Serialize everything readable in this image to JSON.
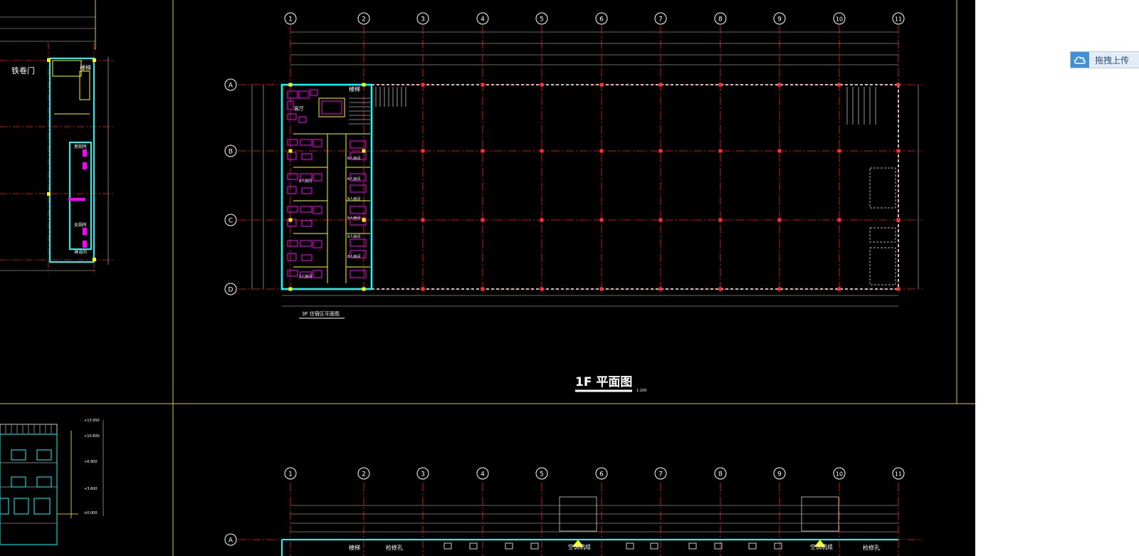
{
  "drawing": {
    "top_plan": {
      "title": "1F 平面图",
      "scale": "1:100",
      "sub_title": "3F 住宿区平面图",
      "grid_cols": [
        "1",
        "2",
        "3",
        "4",
        "5",
        "6",
        "7",
        "8",
        "9",
        "10",
        "11"
      ],
      "grid_rows": [
        "A",
        "B",
        "C",
        "D"
      ],
      "room_labels": [
        "楼梯",
        "客厅",
        "8人房间",
        "8人房间",
        "8人房间",
        "8人房间",
        "8人房间",
        "8人房间",
        "8人房间",
        "2人房间"
      ]
    },
    "left_plan": {
      "labels": [
        "铁卷门",
        "楼梯",
        "男厕所",
        "女厕所",
        "淋浴间"
      ]
    },
    "bottom_plan": {
      "grid_cols": [
        "1",
        "2",
        "3",
        "4",
        "5",
        "6",
        "7",
        "8",
        "9",
        "10",
        "11"
      ],
      "grid_rows": [
        "A"
      ],
      "labels": [
        "楼梯",
        "检修孔",
        "空调机组",
        "空调机组",
        "检修孔"
      ]
    },
    "elevation_labels": [
      "+13.950",
      "+10.800",
      "+6.900",
      "+3.600",
      "±0.000"
    ]
  },
  "upload": {
    "label": "拖拽上传",
    "icon": "cloud-upload-icon"
  },
  "colors": {
    "background": "#000000",
    "axis_red": "#ff2020",
    "wall_cyan": "#00ffff",
    "furniture_magenta": "#ff00ff",
    "text_white": "#ffffff",
    "text_yellow": "#ffff00",
    "frame_yellow": "#d8c838",
    "dim_white": "#cfcfcf"
  }
}
